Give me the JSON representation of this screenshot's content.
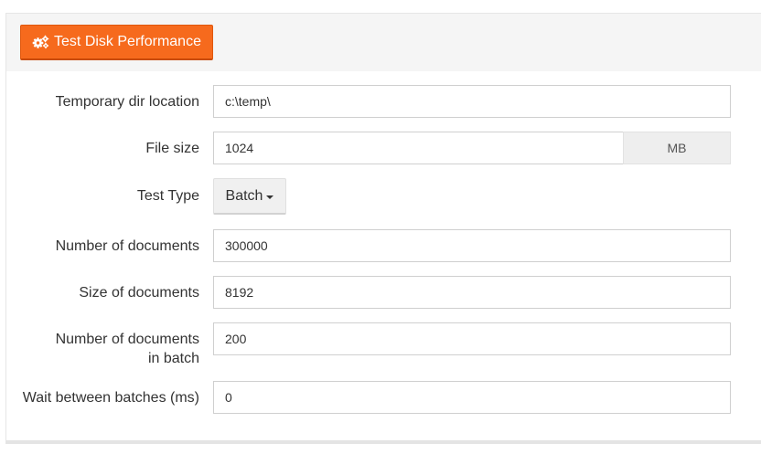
{
  "header": {
    "test_button_label": "Test Disk Performance",
    "test_button_icon": "gears-icon",
    "accent_color": "#f66a1d"
  },
  "form": {
    "temp_dir": {
      "label": "Temporary dir location",
      "value": "c:\\temp\\"
    },
    "file_size": {
      "label": "File size",
      "value": "1024",
      "unit": "MB"
    },
    "test_type": {
      "label": "Test Type",
      "selected": "Batch"
    },
    "num_documents": {
      "label": "Number of documents",
      "value": "300000"
    },
    "size_documents": {
      "label": "Size of documents",
      "value": "8192"
    },
    "num_in_batch": {
      "label_line1": "Number of documents",
      "label_line2": "in batch",
      "value": "200"
    },
    "wait_between": {
      "label": "Wait between batches (ms)",
      "value": "0"
    }
  }
}
